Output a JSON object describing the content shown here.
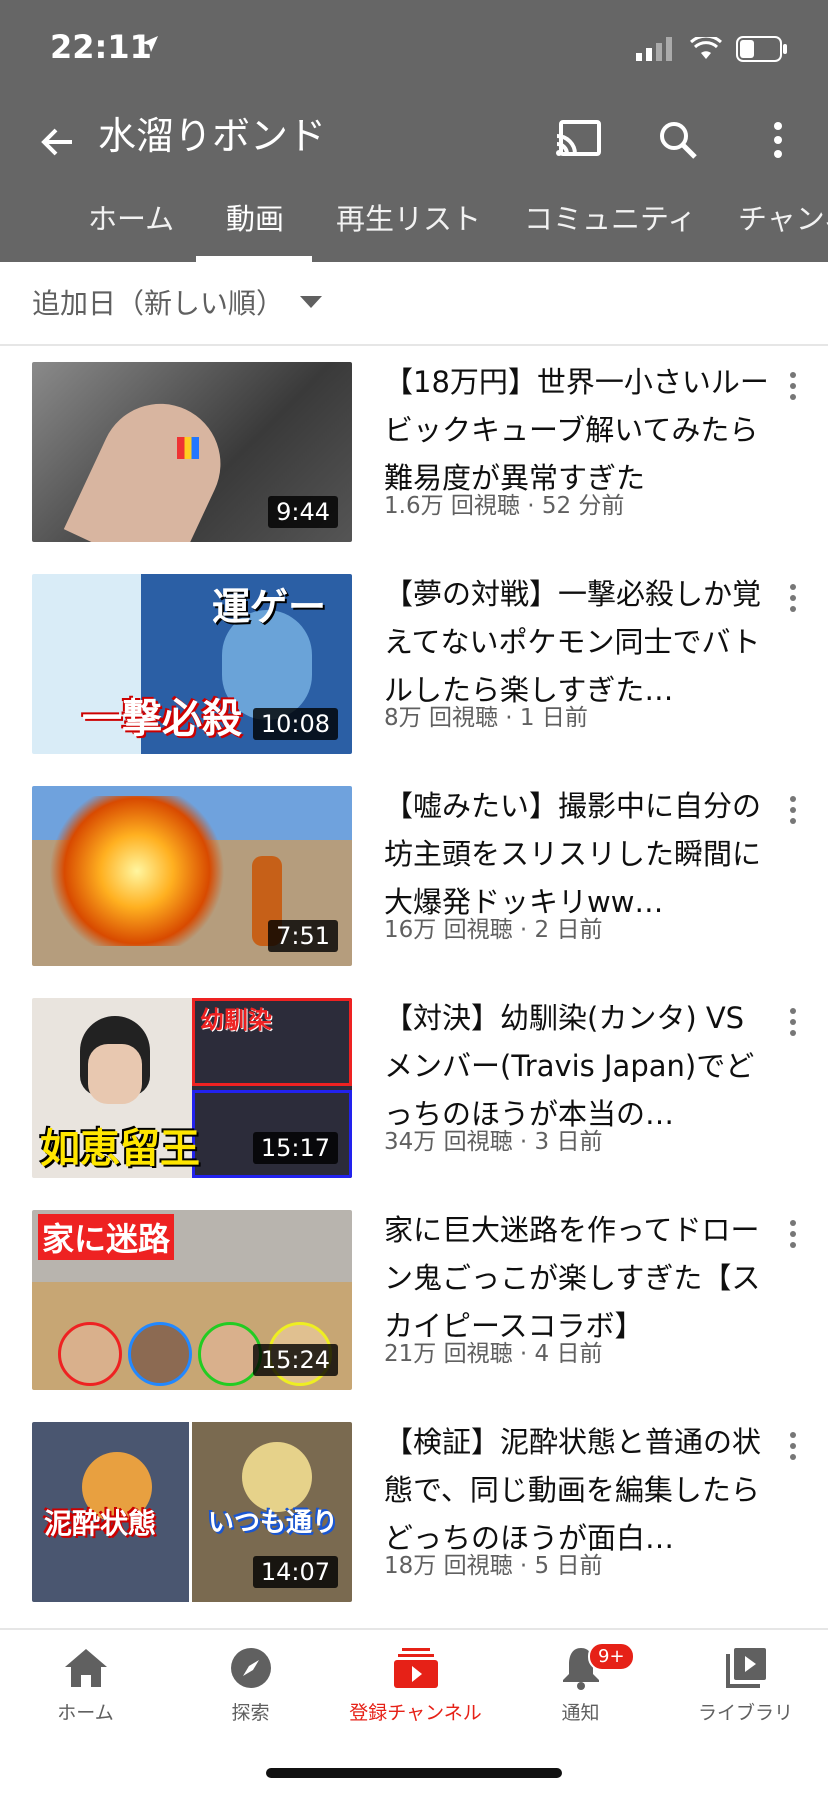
{
  "status": {
    "time": "22:11"
  },
  "header": {
    "title": "水溜りボンド"
  },
  "tabs": [
    {
      "label": "ホーム"
    },
    {
      "label": "動画"
    },
    {
      "label": "再生リスト"
    },
    {
      "label": "コミュニティ"
    },
    {
      "label": "チャンネ"
    }
  ],
  "sort": {
    "label": "追加日（新しい順）"
  },
  "videos": [
    {
      "title": "【18万円】世界一小さいルービックキューブ解いてみたら難易度が異常すぎた",
      "meta": "1.6万 回視聴 · 52 分前",
      "duration": "9:44"
    },
    {
      "title": "【夢の対戦】一撃必殺しか覚えてないポケモン同士でバトルしたら楽しすぎた…",
      "meta": "8万 回視聴 · 1 日前",
      "duration": "10:08"
    },
    {
      "title": "【嘘みたい】撮影中に自分の坊主頭をスリスリした瞬間に大爆発ドッキリww…",
      "meta": "16万 回視聴 · 2 日前",
      "duration": "7:51"
    },
    {
      "title": "【対決】幼馴染(カンタ) VS メンバー(Travis Japan)でどっちのほうが本当の…",
      "meta": "34万 回視聴 · 3 日前",
      "duration": "15:17"
    },
    {
      "title": "家に巨大迷路を作ってドローン鬼ごっこが楽しすぎた【スカイピースコラボ】",
      "meta": "21万 回視聴 · 4 日前",
      "duration": "15:24"
    },
    {
      "title": "【検証】泥酔状態と普通の状態で、同じ動画を編集したらどっちのほうが面白…",
      "meta": "18万 回視聴 · 5 日前",
      "duration": "14:07"
    }
  ],
  "thumb_text": {
    "v2": "運ゲー",
    "v2b": "一撃必殺",
    "v4a": "如恵留王",
    "v4b": "幼馴染",
    "v5": "家に迷路",
    "v6a": "泥酔状態",
    "v6b": "いつも通り"
  },
  "bottom_nav": [
    {
      "label": "ホーム",
      "icon": "home-icon"
    },
    {
      "label": "探索",
      "icon": "explore-icon"
    },
    {
      "label": "登録チャンネル",
      "icon": "subscriptions-icon"
    },
    {
      "label": "通知",
      "icon": "bell-icon",
      "badge": "9+"
    },
    {
      "label": "ライブラリ",
      "icon": "library-icon"
    }
  ],
  "colors": {
    "accent": "#e62117",
    "header_bg": "#666666"
  }
}
